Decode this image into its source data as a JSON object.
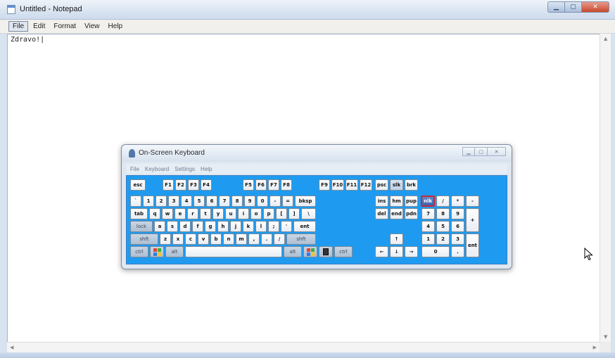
{
  "notepad": {
    "title": "Untitled - Notepad",
    "menu": [
      "File",
      "Edit",
      "Format",
      "View",
      "Help"
    ],
    "text": "Zdravo!|"
  },
  "osk": {
    "title": "On-Screen Keyboard",
    "menu": [
      "File",
      "Keyboard",
      "Settings",
      "Help"
    ],
    "rows": {
      "fn": [
        "esc",
        "F1",
        "F2",
        "F3",
        "F4",
        "F5",
        "F6",
        "F7",
        "F8",
        "F9",
        "F10",
        "F11",
        "F12",
        "psc",
        "slk",
        "brk"
      ],
      "num": [
        "`",
        "1",
        "2",
        "3",
        "4",
        "5",
        "6",
        "7",
        "8",
        "9",
        "0",
        "-",
        "=",
        "bksp"
      ],
      "top": [
        "tab",
        "q",
        "w",
        "e",
        "r",
        "t",
        "y",
        "u",
        "i",
        "o",
        "p",
        "[",
        "]",
        "\\"
      ],
      "home": [
        "lock",
        "a",
        "s",
        "d",
        "f",
        "g",
        "h",
        "j",
        "k",
        "l",
        ";",
        "'",
        "ent"
      ],
      "shift": [
        "shft",
        "z",
        "x",
        "c",
        "v",
        "b",
        "n",
        "m",
        ",",
        ".",
        "/",
        "shft"
      ],
      "bottom": [
        "ctrl",
        "alt",
        "alt",
        "ctrl"
      ],
      "nav1": [
        "ins",
        "hm",
        "pup"
      ],
      "nav2": [
        "del",
        "end",
        "pdn"
      ],
      "arrows": [
        "↑",
        "←",
        "↓",
        "→"
      ],
      "numpad": [
        "nlk",
        "/",
        "*",
        "-",
        "7",
        "8",
        "9",
        "+",
        "4",
        "5",
        "6",
        "1",
        "2",
        "3",
        "ent",
        "0",
        "."
      ]
    }
  },
  "colors": {
    "keyboard_bg": "#1e9bf0",
    "selected_key": "#3b62ad"
  }
}
